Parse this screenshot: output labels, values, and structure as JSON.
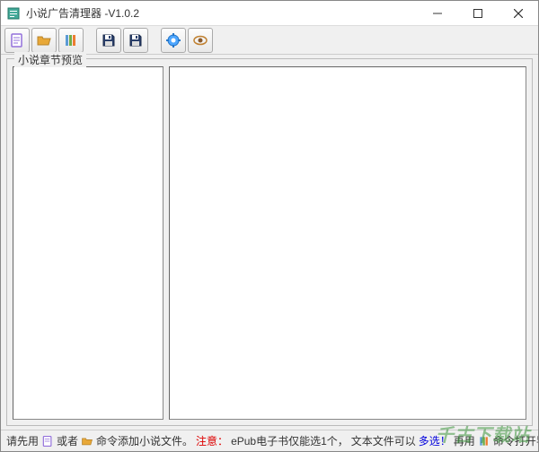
{
  "window": {
    "title": "小说广告清理器  -V1.0.2"
  },
  "toolbar": {
    "icons": {
      "doc": "新建文档",
      "folder": "打开文件夹",
      "books": "导航",
      "save": "保存",
      "save2": "另存",
      "gear": "设置",
      "eye": "预览"
    }
  },
  "fieldset": {
    "label": "小说章节预览"
  },
  "statusbar": {
    "t1": "请先用",
    "t2": "或者",
    "t3": "命令添加小说文件。",
    "t4": "注意：",
    "t5": "ePub电子书仅能选1个，",
    "t6": "文本文件可以",
    "t7": "多选！",
    "t8": "再用",
    "t9": "命令打开导航窗口！"
  },
  "watermark": "千古下载站"
}
